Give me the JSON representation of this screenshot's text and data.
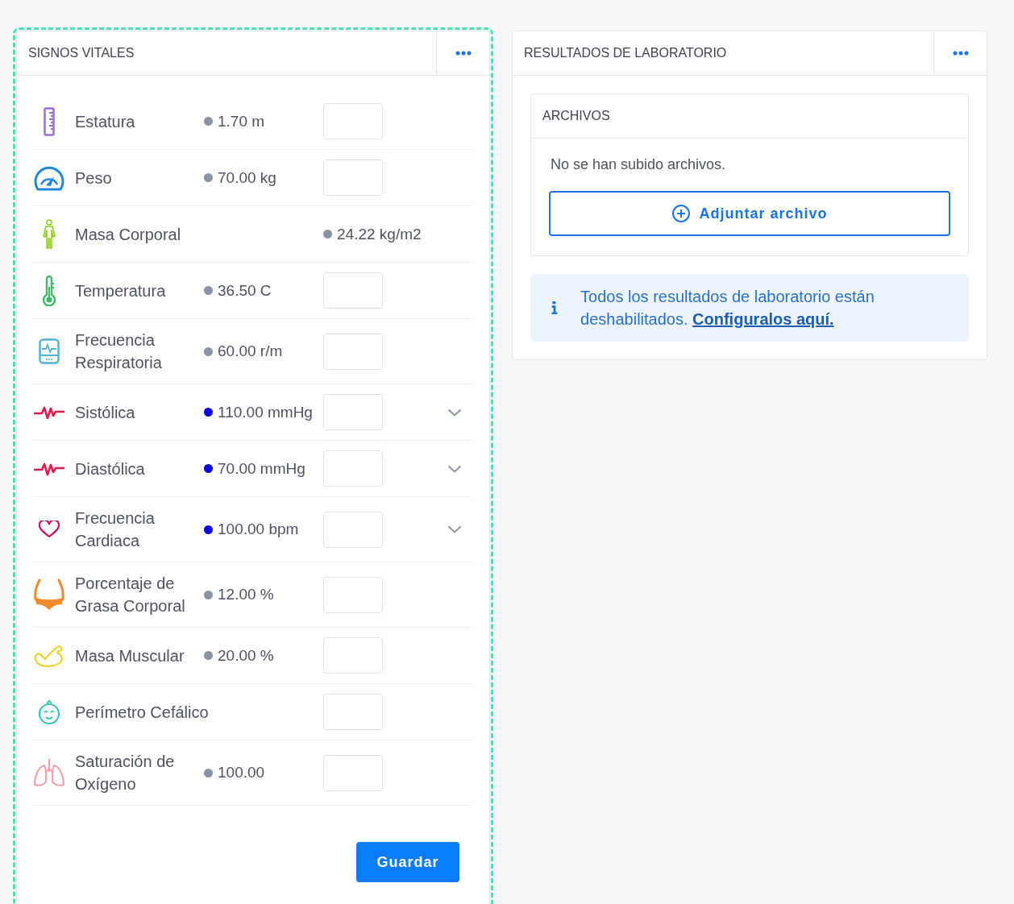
{
  "vitals": {
    "title": "SIGNOS VITALES",
    "rows": [
      {
        "kind": "height",
        "label": "Estatura",
        "reading": "1.70 m",
        "color": "#8a93a6",
        "input": true,
        "expandable": false
      },
      {
        "kind": "weight",
        "label": "Peso",
        "reading": "70.00 kg",
        "color": "#8a93a6",
        "input": true,
        "expandable": false
      },
      {
        "kind": "bmi",
        "label": "Masa Corporal",
        "reading": "24.22 kg/m2",
        "color": "#8a93a6",
        "input": false,
        "expandable": false
      },
      {
        "kind": "temperature",
        "label": "Temperatura",
        "reading": "36.50 C",
        "color": "#8a93a6",
        "input": true,
        "expandable": false
      },
      {
        "kind": "respiration",
        "label": "Frecuencia Respiratoria",
        "reading": "60.00 r/m",
        "color": "#8a93a6",
        "input": true,
        "expandable": false
      },
      {
        "kind": "pulse",
        "label": "Sistólica",
        "reading": "110.00 mmHg",
        "color": "#0a00e0",
        "input": true,
        "expandable": true
      },
      {
        "kind": "pulse",
        "label": "Diastólica",
        "reading": "70.00 mmHg",
        "color": "#0a00e0",
        "input": true,
        "expandable": true
      },
      {
        "kind": "heart",
        "label": "Frecuencia Cardiaca",
        "reading": "100.00 bpm",
        "color": "#0a00e0",
        "input": true,
        "expandable": true
      },
      {
        "kind": "body-fat",
        "label": "Porcentaje de Grasa Corporal",
        "reading": "12.00 %",
        "color": "#8a93a6",
        "input": true,
        "expandable": false
      },
      {
        "kind": "muscle",
        "label": "Masa Muscular",
        "reading": "20.00 %",
        "color": "#8a93a6",
        "input": true,
        "expandable": false
      },
      {
        "kind": "head",
        "label": "Perímetro Cefálico",
        "input": true,
        "expandable": false
      },
      {
        "kind": "lungs",
        "label": "Saturación de Oxígeno",
        "reading": "100.00",
        "color": "#8a93a6",
        "input": true,
        "expandable": false
      }
    ],
    "save_button": "Guardar"
  },
  "lab_results": {
    "title": "RESULTADOS DE LABORATORIO",
    "files": {
      "title": "ARCHIVOS",
      "empty_text": "No se han subido archivos.",
      "attach_button": "Adjuntar archivo"
    },
    "notice": {
      "text": "Todos los resultados de laboratorio están deshabilitados.",
      "link": "Configuralos aquí."
    }
  }
}
